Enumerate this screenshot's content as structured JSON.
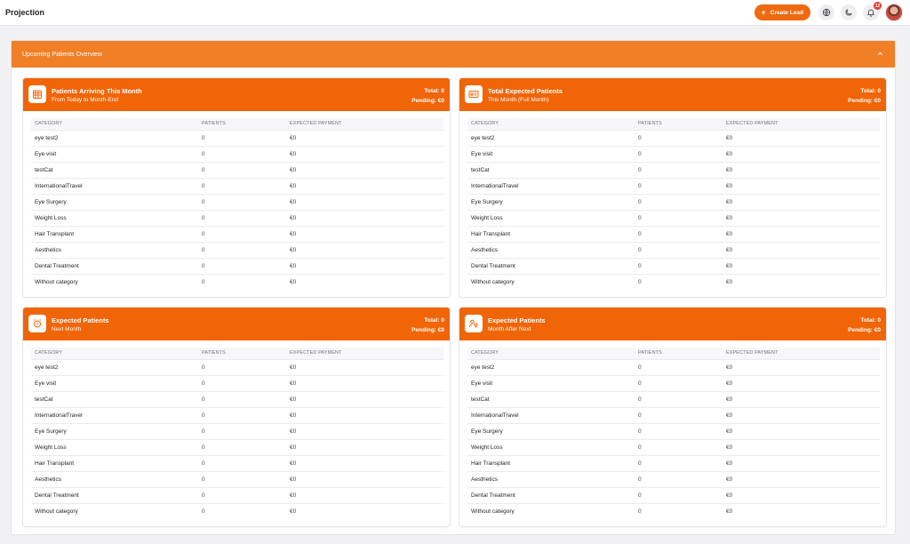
{
  "header": {
    "title": "Projection",
    "create_label": "Create Lead",
    "notification_count": "12"
  },
  "overview": {
    "title": "Upcoming Patients Overview"
  },
  "columns": {
    "category": "CATEGORY",
    "patients": "PATIENTS",
    "payment": "EXPECTED PAYMENT"
  },
  "cards": [
    {
      "title": "Patients Arriving This Month",
      "subtitle": "From Today to Month-End",
      "total": "Total: 0",
      "pending": "Pending: €0",
      "icon": "calendar-grid-icon"
    },
    {
      "title": "Total Expected Patients",
      "subtitle": "This Month (Full Month)",
      "total": "Total: 0",
      "pending": "Pending: €0",
      "icon": "id-card-icon"
    },
    {
      "title": "Expected Patients",
      "subtitle": "Next Month",
      "total": "Total: 0",
      "pending": "Pending: €0",
      "icon": "alarm-clock-icon"
    },
    {
      "title": "Expected Patients",
      "subtitle": "Month After Next",
      "total": "Total: 0",
      "pending": "Pending: €0",
      "icon": "user-pin-icon"
    }
  ],
  "rows": [
    {
      "category": "eye test2",
      "patients": "0",
      "payment": "€0"
    },
    {
      "category": "Eye visit",
      "patients": "0",
      "payment": "€0"
    },
    {
      "category": "testCat",
      "patients": "0",
      "payment": "€0"
    },
    {
      "category": "InternationalTravel",
      "patients": "0",
      "payment": "€0"
    },
    {
      "category": "Eye Surgery",
      "patients": "0",
      "payment": "€0"
    },
    {
      "category": "Weight Loss",
      "patients": "0",
      "payment": "€0"
    },
    {
      "category": "Hair Transplant",
      "patients": "0",
      "payment": "€0"
    },
    {
      "category": "Aesthetics",
      "patients": "0",
      "payment": "€0"
    },
    {
      "category": "Dental Treatment",
      "patients": "0",
      "payment": "€0"
    },
    {
      "category": "Without category",
      "patients": "0",
      "payment": "€0"
    }
  ],
  "colors": {
    "accent": "#f06507",
    "overview_header": "#f07f26",
    "badge": "#e53935"
  }
}
